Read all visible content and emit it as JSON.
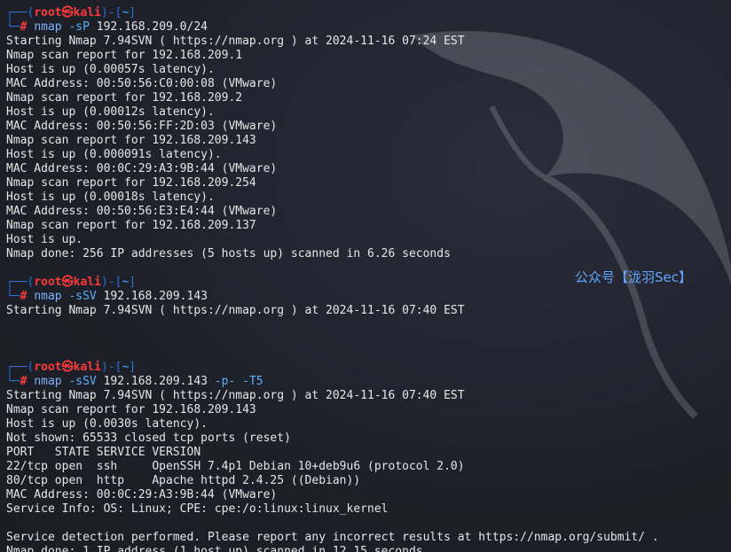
{
  "prompt": {
    "user": "root",
    "skull": "㉿",
    "host": "kali",
    "dir": "~",
    "hash": "#"
  },
  "commands": [
    {
      "cmd": "nmap",
      "flags": "-sP",
      "args": "192.168.209.0/24",
      "tail": ""
    },
    {
      "cmd": "nmap",
      "flags": "-sSV",
      "args": "192.168.209.143",
      "tail": ""
    },
    {
      "cmd": "nmap",
      "flags": "-sSV",
      "args": "192.168.209.143",
      "tail": "-p- -T5"
    }
  ],
  "output1": [
    "Starting Nmap 7.94SVN ( https://nmap.org ) at 2024-11-16 07:24 EST",
    "Nmap scan report for 192.168.209.1",
    "Host is up (0.00057s latency).",
    "MAC Address: 00:50:56:C0:00:08 (VMware)",
    "Nmap scan report for 192.168.209.2",
    "Host is up (0.00012s latency).",
    "MAC Address: 00:50:56:FF:2D:03 (VMware)",
    "Nmap scan report for 192.168.209.143",
    "Host is up (0.000091s latency).",
    "MAC Address: 00:0C:29:A3:9B:44 (VMware)",
    "Nmap scan report for 192.168.209.254",
    "Host is up (0.00018s latency).",
    "MAC Address: 00:50:56:E3:E4:44 (VMware)",
    "Nmap scan report for 192.168.209.137",
    "Host is up.",
    "Nmap done: 256 IP addresses (5 hosts up) scanned in 6.26 seconds"
  ],
  "output2": [
    "Starting Nmap 7.94SVN ( https://nmap.org ) at 2024-11-16 07:40 EST"
  ],
  "output3": [
    "Starting Nmap 7.94SVN ( https://nmap.org ) at 2024-11-16 07:40 EST",
    "Nmap scan report for 192.168.209.143",
    "Host is up (0.0030s latency).",
    "Not shown: 65533 closed tcp ports (reset)",
    "PORT   STATE SERVICE VERSION",
    "22/tcp open  ssh     OpenSSH 7.4p1 Debian 10+deb9u6 (protocol 2.0)",
    "80/tcp open  http    Apache httpd 2.4.25 ((Debian))",
    "MAC Address: 00:0C:29:A3:9B:44 (VMware)",
    "Service Info: OS: Linux; CPE: cpe:/o:linux:linux_kernel",
    "",
    "Service detection performed. Please report any incorrect results at https://nmap.org/submit/ .",
    "Nmap done: 1 IP address (1 host up) scanned in 12.15 seconds"
  ],
  "watermark": "公众号【泷羽Sec】",
  "colors": {
    "background": "#1f212b",
    "prompt_corner": "#2e6fd6",
    "prompt_user": "#ff3b3b",
    "prompt_dir": "#3b8eea",
    "watermark": "#62a6ff"
  }
}
